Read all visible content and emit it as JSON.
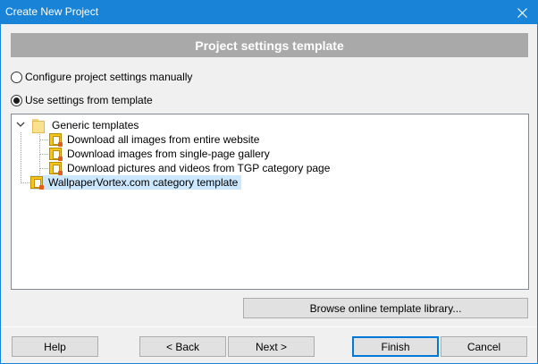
{
  "window": {
    "title": "Create New Project"
  },
  "header": {
    "title": "Project settings template"
  },
  "options": {
    "manual_label": "Configure project settings manually",
    "template_label": "Use settings from template",
    "selected": "template"
  },
  "tree": {
    "group": {
      "label": "Generic templates",
      "expanded": true,
      "items": [
        {
          "label": "Download all images from entire website"
        },
        {
          "label": "Download images from single-page gallery"
        },
        {
          "label": "Download pictures and videos from TGP category page"
        }
      ]
    },
    "custom": {
      "label": "WallpaperVortex.com category template",
      "selected": true
    }
  },
  "buttons": {
    "browse": "Browse online template library...",
    "help": "Help",
    "back": "< Back",
    "next": "Next >",
    "finish": "Finish",
    "cancel": "Cancel"
  },
  "colors": {
    "titlebar": "#1883d7",
    "header_bg": "#a9a9a9",
    "selection": "#cce8ff",
    "default_button_border": "#0078d7"
  }
}
